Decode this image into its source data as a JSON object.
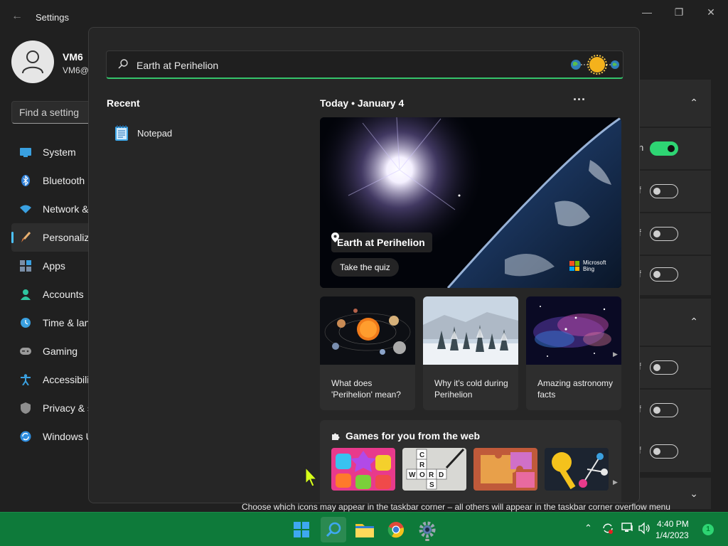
{
  "settings": {
    "app_title": "Settings",
    "user": {
      "name": "VM6",
      "email": "VM6@"
    },
    "search_placeholder": "Find a setting",
    "nav": [
      {
        "label": "System",
        "icon": "monitor-icon"
      },
      {
        "label": "Bluetooth",
        "icon": "bluetooth-icon"
      },
      {
        "label": "Network &",
        "icon": "wifi-icon"
      },
      {
        "label": "Personaliza",
        "icon": "brush-icon",
        "active": true
      },
      {
        "label": "Apps",
        "icon": "apps-icon"
      },
      {
        "label": "Accounts",
        "icon": "person-icon"
      },
      {
        "label": "Time & lan",
        "icon": "clock-icon"
      },
      {
        "label": "Gaming",
        "icon": "gamepad-icon"
      },
      {
        "label": "Accessibili",
        "icon": "accessibility-icon"
      },
      {
        "label": "Privacy & s",
        "icon": "shield-icon"
      },
      {
        "label": "Windows U",
        "icon": "update-icon"
      }
    ],
    "right": {
      "row_fragments": [
        "n",
        "f",
        "f",
        "f",
        "f",
        "f",
        "f"
      ],
      "toggles": [
        true,
        false,
        false,
        false,
        false,
        false,
        false
      ]
    },
    "footer_text": "Choose which icons may appear in the taskbar corner – all others will appear in the taskbar corner overflow menu"
  },
  "search": {
    "query": "Earth at Perihelion",
    "recent_label": "Recent",
    "recent_items": [
      {
        "label": "Notepad",
        "icon": "notepad-icon"
      }
    ],
    "today_label": "Today  •  January 4",
    "more_label": "···",
    "hero": {
      "title": "Earth at Perihelion",
      "quiz_label": "Take the quiz",
      "brand": "Microsoft Bing",
      "brand_line1": "Microsoft",
      "brand_line2": "Bing"
    },
    "topic_cards": [
      {
        "caption": "What does 'Perihelion' mean?"
      },
      {
        "caption": "Why it's cold during Perihelion"
      },
      {
        "caption": "Amazing astronomy facts"
      }
    ],
    "games": {
      "title": "Games for you from the web"
    }
  },
  "taskbar": {
    "time": "4:40 PM",
    "date": "1/4/2023",
    "notification_count": "1"
  },
  "colors": {
    "accent": "#2ed573",
    "taskbar": "#0e7a3a",
    "flyout_bg": "#262626"
  }
}
